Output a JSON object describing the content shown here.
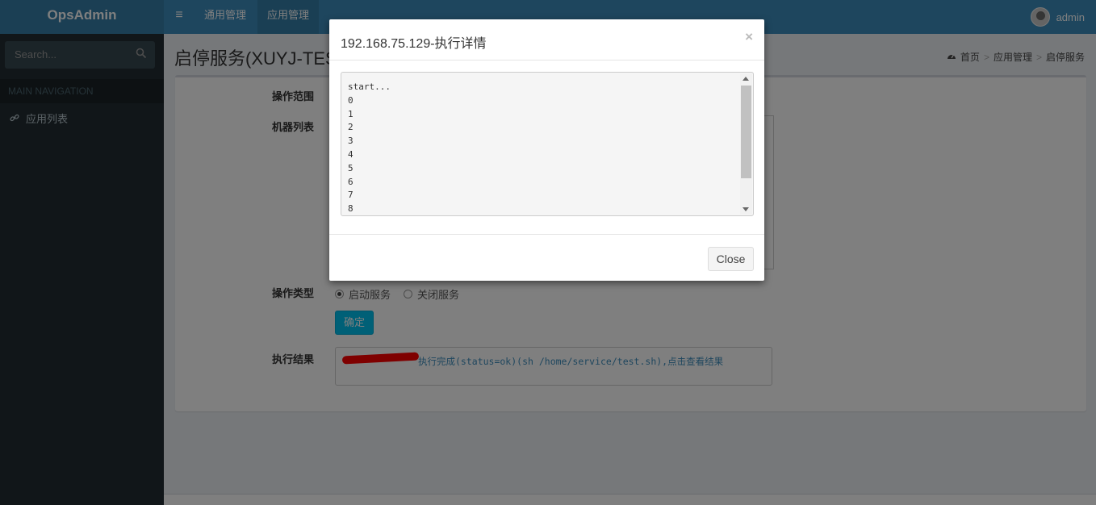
{
  "header": {
    "logo": "OpsAdmin",
    "menu_icon": "≡",
    "nav": [
      {
        "label": "通用管理"
      },
      {
        "label": "应用管理"
      }
    ],
    "user_name": "admin"
  },
  "sidebar": {
    "search_placeholder": "Search...",
    "nav_header": "MAIN NAVIGATION",
    "items": [
      {
        "label": "应用列表",
        "icon": "link-icon"
      }
    ]
  },
  "page": {
    "title": "启停服务(XUYJ-TES",
    "breadcrumb": [
      "首页",
      "应用管理",
      "启停服务"
    ],
    "breadcrumb_sep": ">",
    "form": {
      "scope_label": "操作范围",
      "machines_label": "机器列表",
      "op_type_label": "操作类型",
      "options": [
        {
          "label": "启动服务",
          "checked": true
        },
        {
          "label": "关闭服务",
          "checked": false
        }
      ],
      "confirm_label": "确定",
      "result_label": "执行结果",
      "result_text": "执行完成(status=ok)(sh /home/service/test.sh),点击查看结果"
    }
  },
  "modal": {
    "title": "192.168.75.129-执行详情",
    "close_x": "×",
    "log_lines": [
      "start...",
      "0",
      "1",
      "2",
      "3",
      "4",
      "5",
      "6",
      "7",
      "8"
    ],
    "close_label": "Close"
  },
  "colors": {
    "header": "#3c8dbc",
    "logo_bg": "#367fa9",
    "sidebar": "#222d32",
    "accent_button": "#00c0ef",
    "redaction": "#ff0000"
  }
}
